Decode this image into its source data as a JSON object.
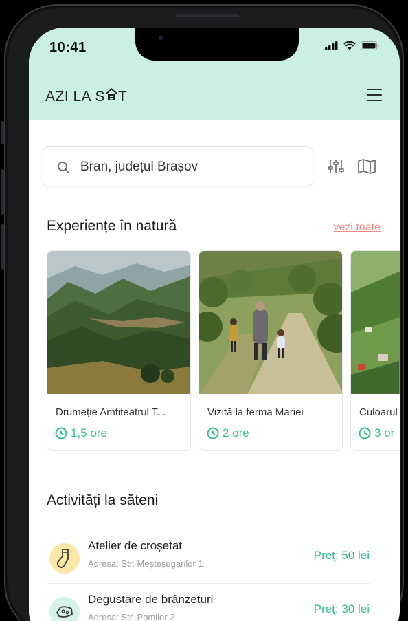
{
  "status_bar": {
    "time": "10:41"
  },
  "app": {
    "brand_left": "AZI LA S",
    "brand_right": "T"
  },
  "search": {
    "value": "Bran, județul Brașov"
  },
  "nature": {
    "title": "Experiențe în natură",
    "see_all": "vezi toate",
    "cards": [
      {
        "title": "Drumeție Amfiteatrul T...",
        "duration": "1,5 ore"
      },
      {
        "title": "Vizită la ferma Mariei",
        "duration": "2 ore"
      },
      {
        "title": "Culoarul",
        "duration": "3 or"
      }
    ]
  },
  "activities": {
    "title": "Activități la săteni",
    "items": [
      {
        "name": "Atelier de croșetat",
        "address": "Adresa: Str. Meșteșugarilor 1",
        "price": "Preț: 50 lei",
        "icon": "sock-icon"
      },
      {
        "name": "Degustare de brânzeturi",
        "address": "Adresa: Str. Pomilor 2",
        "price": "Preț: 30 lei",
        "icon": "cheese-icon"
      }
    ]
  },
  "colors": {
    "header_bg": "#c9f0e1",
    "accent": "#2fbf8f",
    "link": "#f08a8a"
  }
}
